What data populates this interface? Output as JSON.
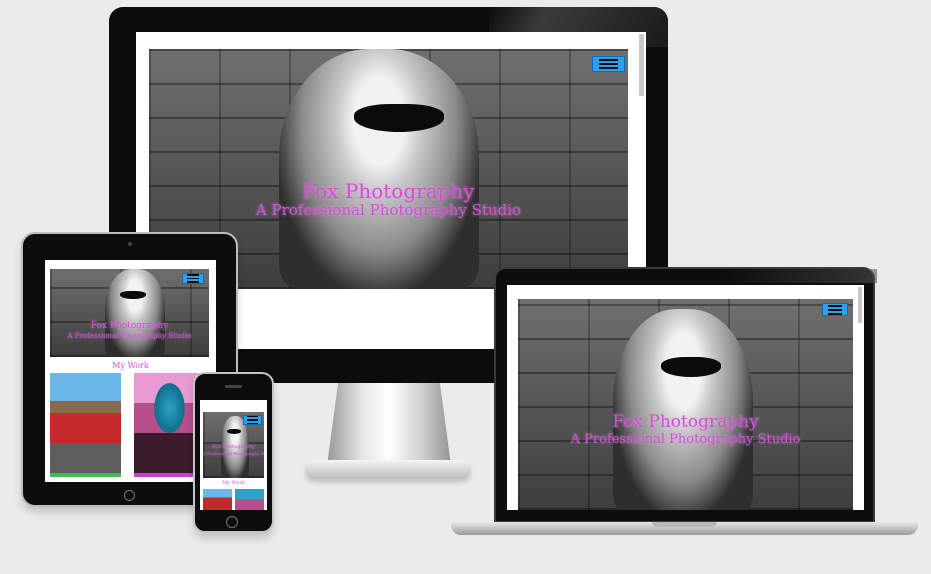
{
  "site": {
    "brand": "Fox Photography",
    "tagline": "A Professional Photography Studio",
    "section_heading": "My Work"
  },
  "icons": {
    "menu": "hamburger-menu-icon"
  },
  "colors": {
    "accent_text": "#d24fd8",
    "menu_button": "#2aa1ee",
    "background": "#ebebeb"
  }
}
